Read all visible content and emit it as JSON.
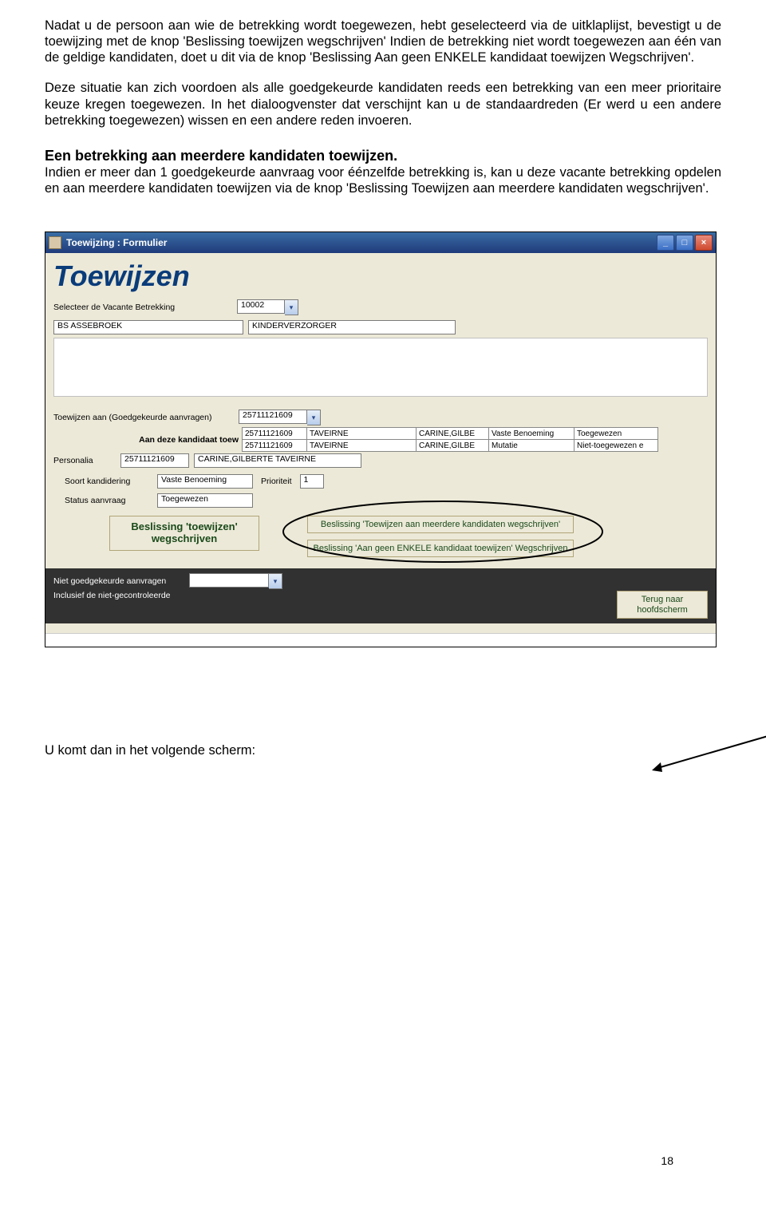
{
  "doc": {
    "para1": "Nadat u de persoon aan wie de betrekking wordt toegewezen, hebt geselecteerd via de uitklaplijst, bevestigt u de toewijzing met de knop 'Beslissing toewijzen wegschrijven' Indien de betrekking niet wordt toegewezen aan één van de geldige kandidaten, doet u dit via de knop 'Beslissing Aan geen ENKELE kandidaat toewijzen Wegschrijven'.",
    "para2": "Deze situatie kan zich voordoen als alle goedgekeurde kandidaten reeds een betrekking van een meer prioritaire keuze kregen toegewezen. In het dialoogvenster dat verschijnt kan u de standaardreden (Er werd u een andere betrekking toegewezen) wissen en een andere reden invoeren.",
    "heading": "Een betrekking aan meerdere kandidaten toewijzen.",
    "para3": "Indien er meer dan 1 goedgekeurde aanvraag voor éénzelfde betrekking is, kan u deze vacante betrekking opdelen en aan meerdere kandidaten toewijzen via de knop 'Beslissing Toewijzen aan meerdere kandidaten wegschrijven'.",
    "footer": "U komt dan in het volgende scherm:",
    "page_number": "18"
  },
  "win": {
    "title": "Toewijzing : Formulier",
    "heading": "Toewijzen",
    "lbl_select_betrekking": "Selecteer de Vacante Betrekking",
    "val_betrekking_id": "10002",
    "val_school": "BS ASSEBROEK",
    "val_functie": "KINDERVERZORGER",
    "lbl_toewijzen_aan": "Toewijzen aan (Goedgekeurde aanvragen)",
    "val_kand_id": "25711121609",
    "lbl_aan_deze": "Aan deze kandidaat toew",
    "grid": {
      "rows": [
        {
          "c1": "25711121609",
          "c2": "TAVEIRNE",
          "c3": "CARINE,GILBE",
          "c4": "Vaste Benoeming",
          "c5": "Toegewezen"
        },
        {
          "c1": "25711121609",
          "c2": "TAVEIRNE",
          "c3": "CARINE,GILBE",
          "c4": "Mutatie",
          "c5": "Niet-toegewezen e"
        }
      ]
    },
    "lbl_personalia": "Personalia",
    "val_personalia_id": "25711121609",
    "val_personalia_name": "CARINE,GILBERTE TAVEIRNE",
    "lbl_soort": "Soort kandidering",
    "val_soort": "Vaste Benoeming",
    "lbl_prioriteit": "Prioriteit",
    "val_prioriteit": "1",
    "lbl_status": "Status aanvraag",
    "val_status": "Toegewezen",
    "btn_beslissing_toewijzen": "Beslissing 'toewijzen' wegschrijven",
    "btn_meerdere": "Beslissing 'Toewijzen aan meerdere kandidaten wegschrijven'",
    "btn_geen_enkele": "Beslissing 'Aan geen ENKELE kandidaat toewijzen' Wegschrijven",
    "lbl_niet_goed": "Niet goedgekeurde aanvragen",
    "lbl_inclusief": "Inclusief de niet-gecontroleerde",
    "btn_terug": "Terug naar hoofdscherm"
  }
}
